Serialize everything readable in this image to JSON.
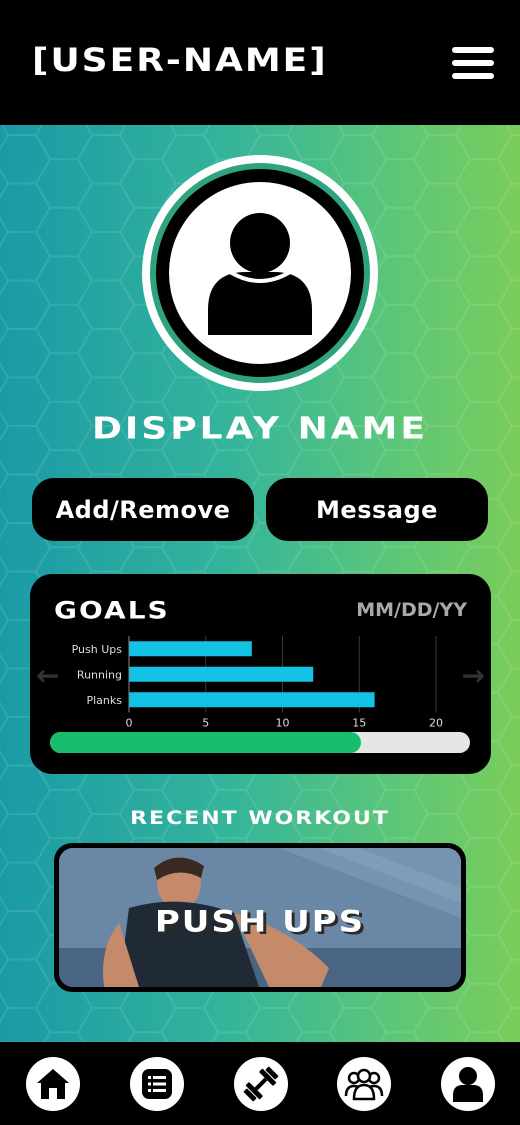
{
  "header": {
    "username": "[USER-NAME]",
    "menu_icon": "hamburger-menu-icon"
  },
  "profile": {
    "avatar_icon": "user-avatar-icon",
    "display_name": "DISPLAY NAME"
  },
  "actions": {
    "add_remove_label": "Add/Remove",
    "message_label": "Message"
  },
  "goals": {
    "title": "GOALS",
    "date": "MM/DD/YY",
    "progress_fraction": 0.74,
    "colors": {
      "bar": "#12c3e6",
      "progress": "#17be6b"
    }
  },
  "chart_data": {
    "type": "bar",
    "orientation": "horizontal",
    "categories": [
      "Push Ups",
      "Running",
      "Planks"
    ],
    "values": [
      8,
      12,
      16
    ],
    "xlim": [
      0,
      20
    ],
    "xticks": [
      "0",
      "5",
      "10",
      "15",
      "20"
    ],
    "grid": true
  },
  "recent": {
    "title": "RECENT WORKOUT",
    "workout_label": "PUSH UPS"
  },
  "nav": {
    "items": [
      {
        "icon": "home-icon"
      },
      {
        "icon": "list-icon"
      },
      {
        "icon": "dumbbell-icon"
      },
      {
        "icon": "group-icon"
      },
      {
        "icon": "profile-icon"
      }
    ]
  }
}
